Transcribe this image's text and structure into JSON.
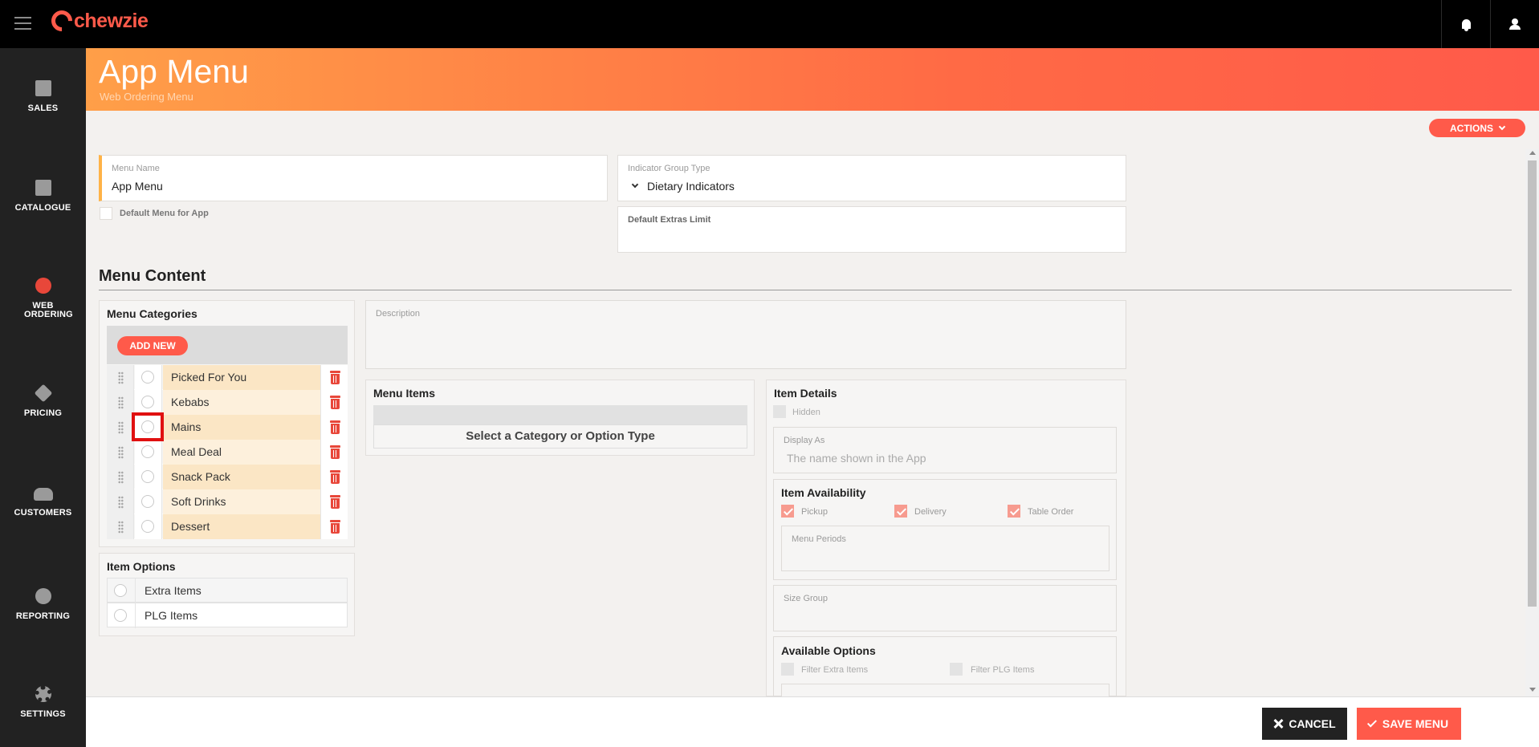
{
  "app": {
    "brand": "chewzie",
    "brand_color": "#ff5a4a"
  },
  "sidebar": {
    "items": [
      {
        "label": "SALES",
        "icon": "receipt-icon"
      },
      {
        "label": "CATALOGUE",
        "icon": "book-icon"
      },
      {
        "label": "WEB ORDERING",
        "icon": "globe-icon",
        "active": true
      },
      {
        "label": "PRICING",
        "icon": "tag-icon"
      },
      {
        "label": "CUSTOMERS",
        "icon": "users-icon"
      },
      {
        "label": "REPORTING",
        "icon": "pie-chart-icon"
      },
      {
        "label": "SETTINGS",
        "icon": "gear-icon"
      }
    ]
  },
  "header": {
    "title": "App Menu",
    "subtitle": "Web Ordering Menu"
  },
  "actions_label": "ACTIONS",
  "form": {
    "menu_name": {
      "label": "Menu Name",
      "value": "App Menu"
    },
    "default_menu_label": "Default Menu for App",
    "indicator_group": {
      "label": "Indicator Group Type",
      "value": "Dietary Indicators"
    },
    "extras_limit": {
      "label": "Default Extras Limit",
      "value": ""
    }
  },
  "menu_content": {
    "title": "Menu Content",
    "categories": {
      "title": "Menu Categories",
      "add_label": "ADD NEW",
      "items": [
        "Picked For You",
        "Kebabs",
        "Mains",
        "Meal Deal",
        "Snack Pack",
        "Soft Drinks",
        "Dessert"
      ]
    },
    "item_options": {
      "title": "Item Options",
      "items": [
        "Extra Items",
        "PLG Items"
      ]
    },
    "description_label": "Description",
    "menu_items": {
      "title": "Menu Items",
      "empty_text": "Select a Category or Option Type"
    },
    "item_details": {
      "title": "Item Details",
      "hidden_label": "Hidden",
      "display_as": {
        "label": "Display As",
        "placeholder": "The name shown in the App"
      },
      "availability": {
        "title": "Item Availability",
        "options": [
          {
            "label": "Pickup",
            "checked": true
          },
          {
            "label": "Delivery",
            "checked": true
          },
          {
            "label": "Table Order",
            "checked": true
          }
        ],
        "menu_periods_label": "Menu Periods"
      },
      "size_group_label": "Size Group",
      "available_options": {
        "title": "Available Options",
        "filter_extra": "Filter Extra Items",
        "filter_plg": "Filter PLG Items"
      }
    }
  },
  "footer": {
    "cancel_label": "CANCEL",
    "save_label": "SAVE MENU"
  }
}
